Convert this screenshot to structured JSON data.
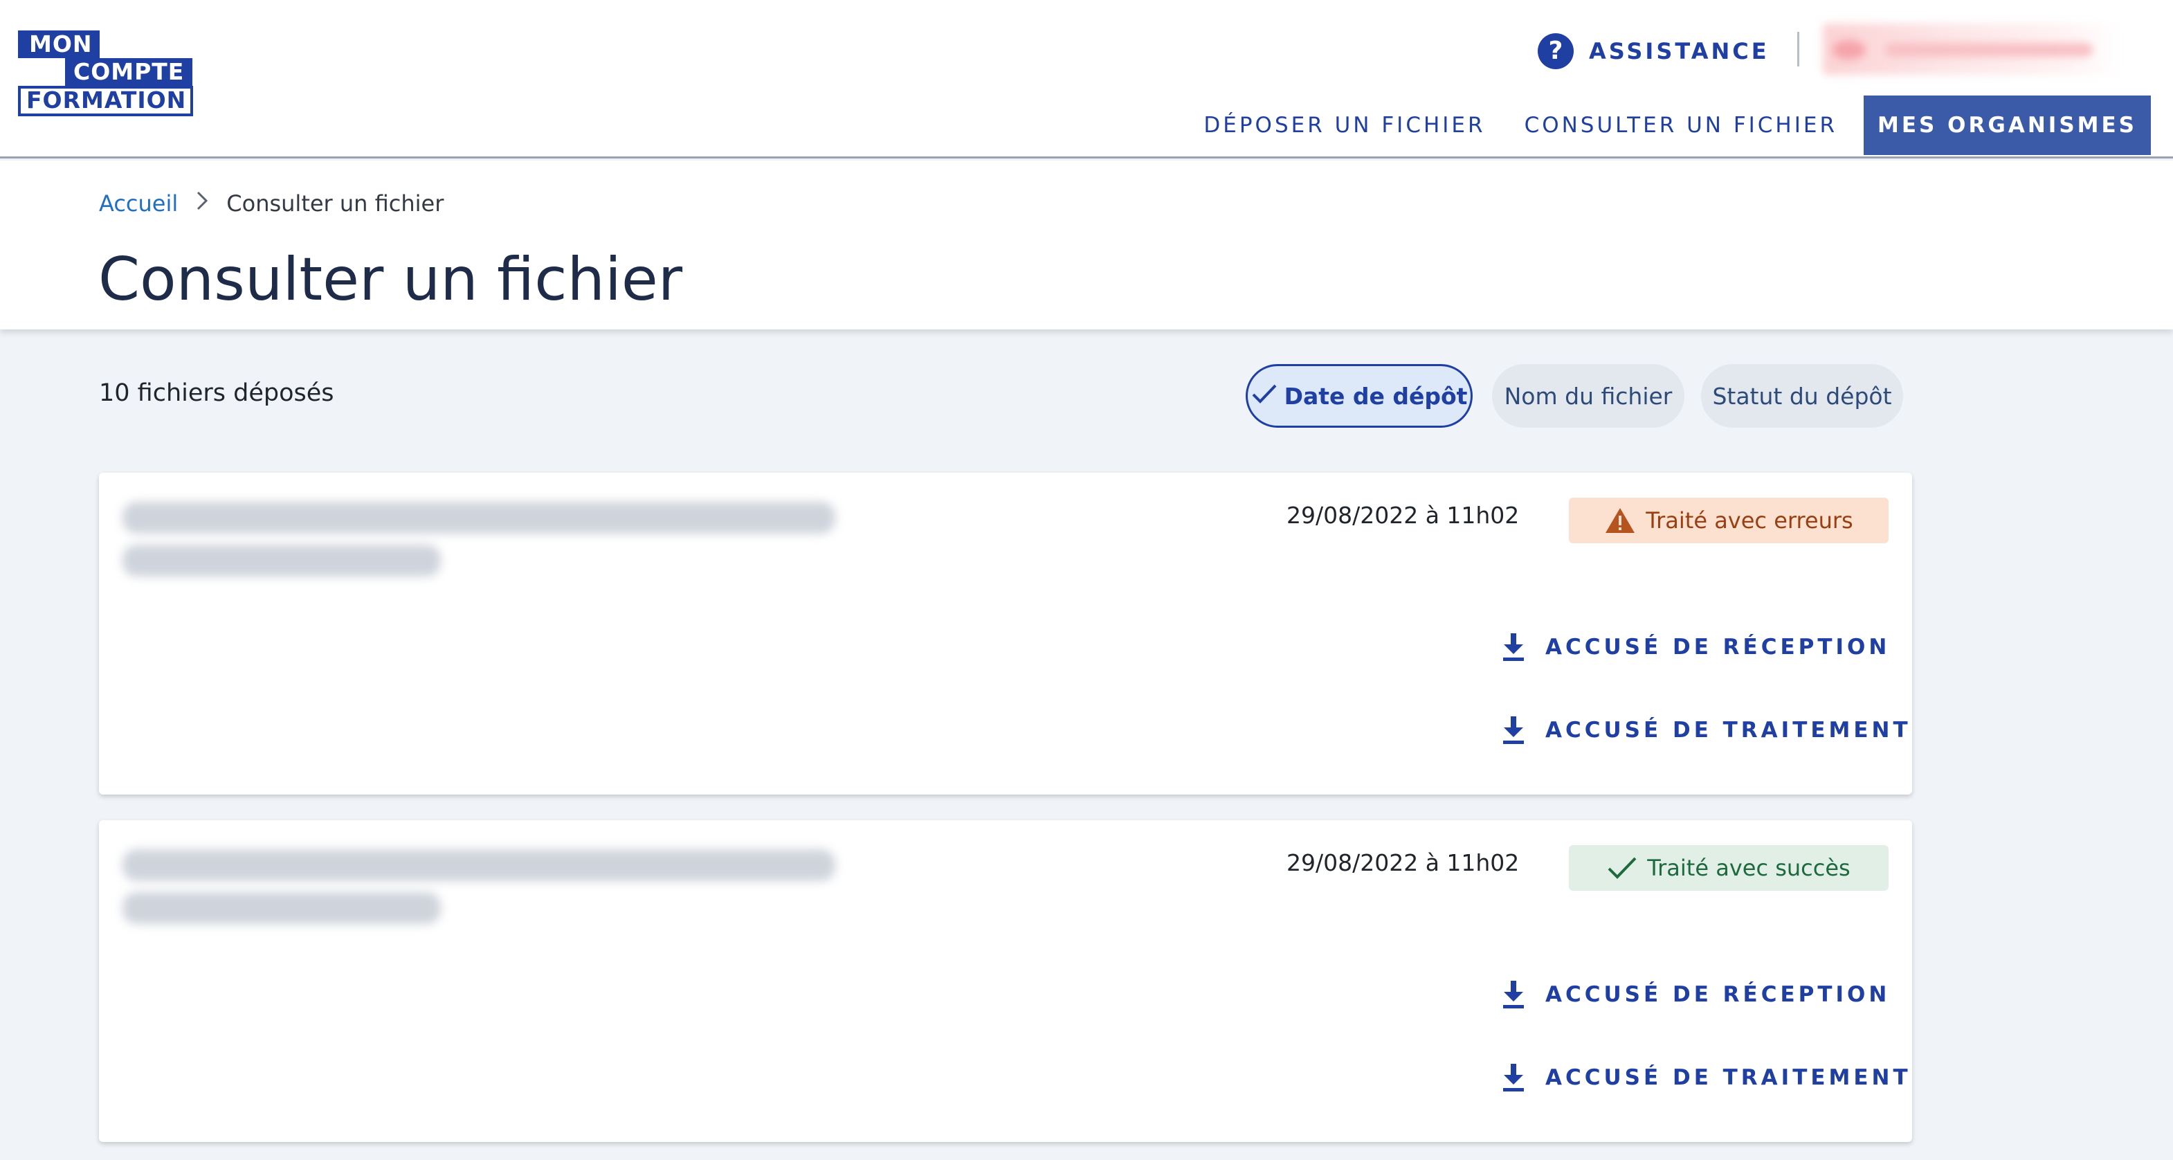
{
  "logo": {
    "line1": "MON",
    "line2": "COMPTE",
    "line3": "FORMATION"
  },
  "header": {
    "assistance_label": "ASSISTANCE",
    "nav": [
      {
        "label": "DÉPOSER UN FICHIER"
      },
      {
        "label": "CONSULTER UN FICHIER"
      },
      {
        "label": "MES ORGANISMES"
      }
    ]
  },
  "breadcrumb": {
    "home": "Accueil",
    "current": "Consulter un fichier"
  },
  "page_title": "Consulter un fichier",
  "toolbar": {
    "count": "10 fichiers déposés",
    "sort_options": [
      {
        "label": "Date de dépôt",
        "selected": true
      },
      {
        "label": "Nom du fichier",
        "selected": false
      },
      {
        "label": "Statut du dépôt",
        "selected": false
      }
    ]
  },
  "files": [
    {
      "date": "29/08/2022 à 11h02",
      "status": "Traité avec erreurs",
      "status_kind": "error",
      "actions": [
        {
          "label": "ACCUSÉ DE RÉCEPTION"
        },
        {
          "label": "ACCUSÉ DE TRAITEMENT"
        }
      ]
    },
    {
      "date": "29/08/2022 à 11h02",
      "status": "Traité avec succès",
      "status_kind": "success",
      "actions": [
        {
          "label": "ACCUSÉ DE RÉCEPTION"
        },
        {
          "label": "ACCUSÉ DE TRAITEMENT"
        }
      ]
    }
  ],
  "colors": {
    "brand": "#1f3fa2",
    "error_bg": "#fde1d0",
    "error_fg": "#9a3f12",
    "success_bg": "#e2efe6",
    "success_fg": "#1d6a3e",
    "page_bg": "#f0f4f8"
  },
  "icons": {
    "help": "question-circle-icon",
    "breadcrumb_sep": "chevron-right-icon",
    "selected": "check-icon",
    "warning": "warning-triangle-icon",
    "success": "check-icon",
    "download": "download-icon"
  }
}
